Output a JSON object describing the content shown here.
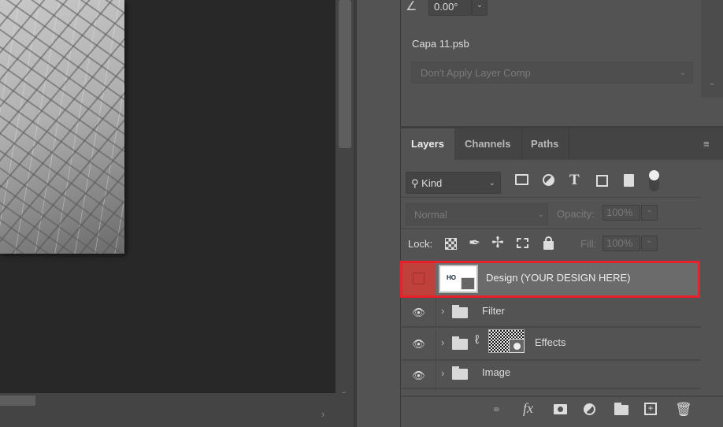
{
  "properties": {
    "angle": "0.00°",
    "file_name": "Capa 11.psb",
    "layer_comp": "Don't Apply Layer Comp"
  },
  "layers_panel": {
    "tabs": [
      {
        "label": "Layers",
        "active": true
      },
      {
        "label": "Channels",
        "active": false
      },
      {
        "label": "Paths",
        "active": false
      }
    ],
    "filter_kind": "Kind",
    "blend_mode": "Normal",
    "opacity_label": "Opacity:",
    "opacity": "100%",
    "lock_label": "Lock:",
    "fill_label": "Fill:",
    "fill": "100%",
    "layers": [
      {
        "name": "Design (YOUR DESIGN HERE)",
        "type": "smart-object",
        "visible": false,
        "selected": true
      },
      {
        "name": "Filter",
        "type": "group",
        "visible": true
      },
      {
        "name": "Effects",
        "type": "group-masked",
        "visible": true
      },
      {
        "name": "Image",
        "type": "group",
        "visible": true
      }
    ],
    "highlight_color": "#e8202a"
  }
}
